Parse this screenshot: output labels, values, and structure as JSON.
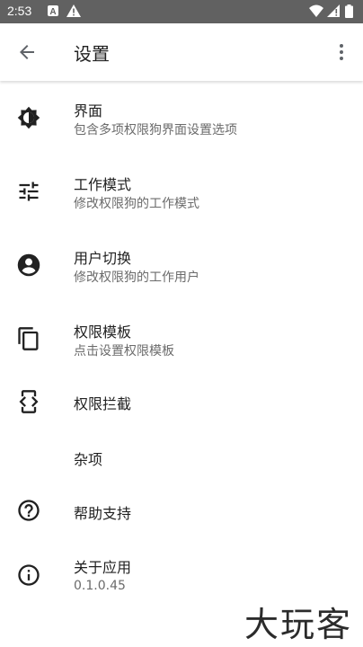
{
  "status": {
    "time": "2:53"
  },
  "appbar": {
    "title": "设置"
  },
  "settings": [
    {
      "title": "界面",
      "subtitle": "包含多项权限狗界面设置选项",
      "icon": "brightness-icon"
    },
    {
      "title": "工作模式",
      "subtitle": "修改权限狗的工作模式",
      "icon": "tune-sliders-icon"
    },
    {
      "title": "用户切换",
      "subtitle": "修改权限狗的工作用户",
      "icon": "account-circle-icon"
    },
    {
      "title": "权限模板",
      "subtitle": "点击设置权限模板",
      "icon": "copy-icon"
    },
    {
      "title": "权限拦截",
      "subtitle": "",
      "icon": "code-brackets-icon"
    },
    {
      "title": "杂项",
      "subtitle": "",
      "icon": ""
    },
    {
      "title": "帮助支持",
      "subtitle": "",
      "icon": "help-circle-icon"
    },
    {
      "title": "关于应用",
      "subtitle": "0.1.0.45",
      "icon": "info-circle-icon"
    }
  ],
  "watermark": "大玩客",
  "colors": {
    "statusbar": "#616161",
    "text": "#212121",
    "subtext": "#6b6b6b"
  }
}
